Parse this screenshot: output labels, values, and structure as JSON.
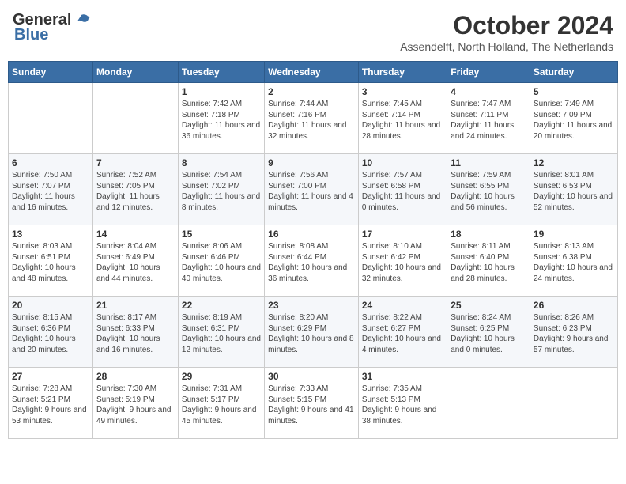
{
  "header": {
    "logo_general": "General",
    "logo_blue": "Blue",
    "month_year": "October 2024",
    "location": "Assendelft, North Holland, The Netherlands"
  },
  "days_of_week": [
    "Sunday",
    "Monday",
    "Tuesday",
    "Wednesday",
    "Thursday",
    "Friday",
    "Saturday"
  ],
  "weeks": [
    [
      {
        "day": "",
        "sunrise": "",
        "sunset": "",
        "daylight": ""
      },
      {
        "day": "",
        "sunrise": "",
        "sunset": "",
        "daylight": ""
      },
      {
        "day": "1",
        "sunrise": "Sunrise: 7:42 AM",
        "sunset": "Sunset: 7:18 PM",
        "daylight": "Daylight: 11 hours and 36 minutes."
      },
      {
        "day": "2",
        "sunrise": "Sunrise: 7:44 AM",
        "sunset": "Sunset: 7:16 PM",
        "daylight": "Daylight: 11 hours and 32 minutes."
      },
      {
        "day": "3",
        "sunrise": "Sunrise: 7:45 AM",
        "sunset": "Sunset: 7:14 PM",
        "daylight": "Daylight: 11 hours and 28 minutes."
      },
      {
        "day": "4",
        "sunrise": "Sunrise: 7:47 AM",
        "sunset": "Sunset: 7:11 PM",
        "daylight": "Daylight: 11 hours and 24 minutes."
      },
      {
        "day": "5",
        "sunrise": "Sunrise: 7:49 AM",
        "sunset": "Sunset: 7:09 PM",
        "daylight": "Daylight: 11 hours and 20 minutes."
      }
    ],
    [
      {
        "day": "6",
        "sunrise": "Sunrise: 7:50 AM",
        "sunset": "Sunset: 7:07 PM",
        "daylight": "Daylight: 11 hours and 16 minutes."
      },
      {
        "day": "7",
        "sunrise": "Sunrise: 7:52 AM",
        "sunset": "Sunset: 7:05 PM",
        "daylight": "Daylight: 11 hours and 12 minutes."
      },
      {
        "day": "8",
        "sunrise": "Sunrise: 7:54 AM",
        "sunset": "Sunset: 7:02 PM",
        "daylight": "Daylight: 11 hours and 8 minutes."
      },
      {
        "day": "9",
        "sunrise": "Sunrise: 7:56 AM",
        "sunset": "Sunset: 7:00 PM",
        "daylight": "Daylight: 11 hours and 4 minutes."
      },
      {
        "day": "10",
        "sunrise": "Sunrise: 7:57 AM",
        "sunset": "Sunset: 6:58 PM",
        "daylight": "Daylight: 11 hours and 0 minutes."
      },
      {
        "day": "11",
        "sunrise": "Sunrise: 7:59 AM",
        "sunset": "Sunset: 6:55 PM",
        "daylight": "Daylight: 10 hours and 56 minutes."
      },
      {
        "day": "12",
        "sunrise": "Sunrise: 8:01 AM",
        "sunset": "Sunset: 6:53 PM",
        "daylight": "Daylight: 10 hours and 52 minutes."
      }
    ],
    [
      {
        "day": "13",
        "sunrise": "Sunrise: 8:03 AM",
        "sunset": "Sunset: 6:51 PM",
        "daylight": "Daylight: 10 hours and 48 minutes."
      },
      {
        "day": "14",
        "sunrise": "Sunrise: 8:04 AM",
        "sunset": "Sunset: 6:49 PM",
        "daylight": "Daylight: 10 hours and 44 minutes."
      },
      {
        "day": "15",
        "sunrise": "Sunrise: 8:06 AM",
        "sunset": "Sunset: 6:46 PM",
        "daylight": "Daylight: 10 hours and 40 minutes."
      },
      {
        "day": "16",
        "sunrise": "Sunrise: 8:08 AM",
        "sunset": "Sunset: 6:44 PM",
        "daylight": "Daylight: 10 hours and 36 minutes."
      },
      {
        "day": "17",
        "sunrise": "Sunrise: 8:10 AM",
        "sunset": "Sunset: 6:42 PM",
        "daylight": "Daylight: 10 hours and 32 minutes."
      },
      {
        "day": "18",
        "sunrise": "Sunrise: 8:11 AM",
        "sunset": "Sunset: 6:40 PM",
        "daylight": "Daylight: 10 hours and 28 minutes."
      },
      {
        "day": "19",
        "sunrise": "Sunrise: 8:13 AM",
        "sunset": "Sunset: 6:38 PM",
        "daylight": "Daylight: 10 hours and 24 minutes."
      }
    ],
    [
      {
        "day": "20",
        "sunrise": "Sunrise: 8:15 AM",
        "sunset": "Sunset: 6:36 PM",
        "daylight": "Daylight: 10 hours and 20 minutes."
      },
      {
        "day": "21",
        "sunrise": "Sunrise: 8:17 AM",
        "sunset": "Sunset: 6:33 PM",
        "daylight": "Daylight: 10 hours and 16 minutes."
      },
      {
        "day": "22",
        "sunrise": "Sunrise: 8:19 AM",
        "sunset": "Sunset: 6:31 PM",
        "daylight": "Daylight: 10 hours and 12 minutes."
      },
      {
        "day": "23",
        "sunrise": "Sunrise: 8:20 AM",
        "sunset": "Sunset: 6:29 PM",
        "daylight": "Daylight: 10 hours and 8 minutes."
      },
      {
        "day": "24",
        "sunrise": "Sunrise: 8:22 AM",
        "sunset": "Sunset: 6:27 PM",
        "daylight": "Daylight: 10 hours and 4 minutes."
      },
      {
        "day": "25",
        "sunrise": "Sunrise: 8:24 AM",
        "sunset": "Sunset: 6:25 PM",
        "daylight": "Daylight: 10 hours and 0 minutes."
      },
      {
        "day": "26",
        "sunrise": "Sunrise: 8:26 AM",
        "sunset": "Sunset: 6:23 PM",
        "daylight": "Daylight: 9 hours and 57 minutes."
      }
    ],
    [
      {
        "day": "27",
        "sunrise": "Sunrise: 7:28 AM",
        "sunset": "Sunset: 5:21 PM",
        "daylight": "Daylight: 9 hours and 53 minutes."
      },
      {
        "day": "28",
        "sunrise": "Sunrise: 7:30 AM",
        "sunset": "Sunset: 5:19 PM",
        "daylight": "Daylight: 9 hours and 49 minutes."
      },
      {
        "day": "29",
        "sunrise": "Sunrise: 7:31 AM",
        "sunset": "Sunset: 5:17 PM",
        "daylight": "Daylight: 9 hours and 45 minutes."
      },
      {
        "day": "30",
        "sunrise": "Sunrise: 7:33 AM",
        "sunset": "Sunset: 5:15 PM",
        "daylight": "Daylight: 9 hours and 41 minutes."
      },
      {
        "day": "31",
        "sunrise": "Sunrise: 7:35 AM",
        "sunset": "Sunset: 5:13 PM",
        "daylight": "Daylight: 9 hours and 38 minutes."
      },
      {
        "day": "",
        "sunrise": "",
        "sunset": "",
        "daylight": ""
      },
      {
        "day": "",
        "sunrise": "",
        "sunset": "",
        "daylight": ""
      }
    ]
  ]
}
